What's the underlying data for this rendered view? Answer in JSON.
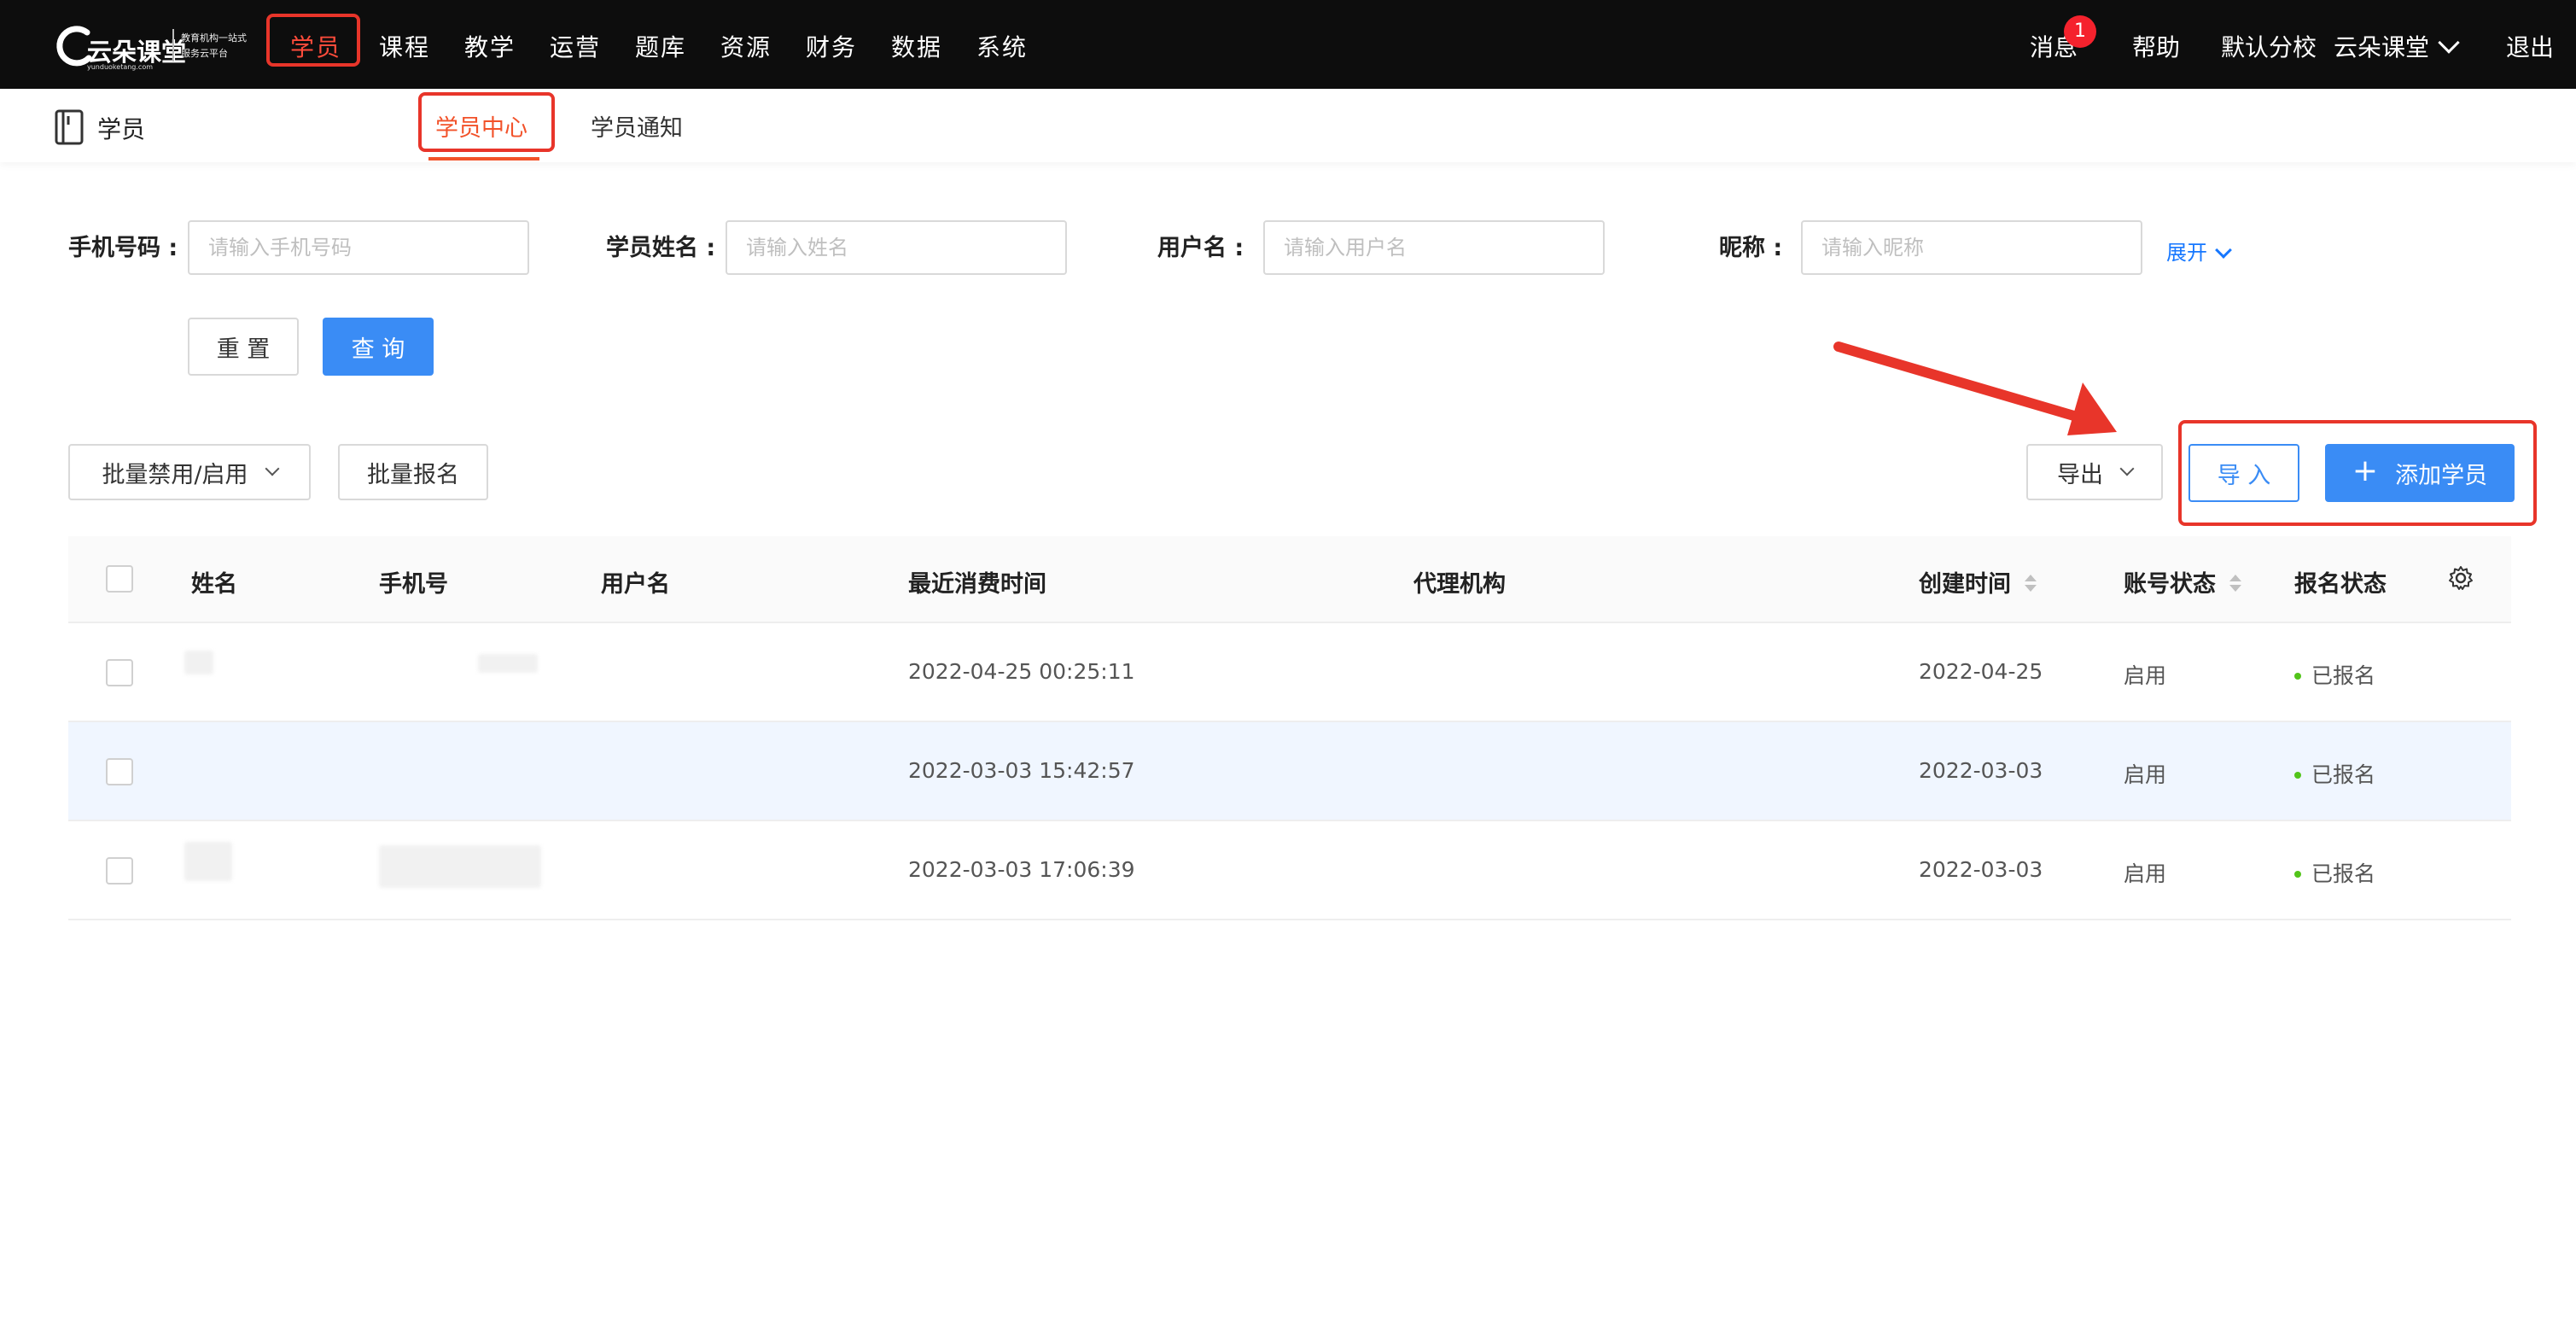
{
  "app": {
    "logo_name": "云朵课堂",
    "logo_domain": "yunduoketang.com",
    "logo_tagline": "教育机构一站式服务云平台"
  },
  "nav": {
    "items": [
      "学员",
      "课程",
      "教学",
      "运营",
      "题库",
      "资源",
      "财务",
      "数据",
      "系统"
    ],
    "active_index": 0
  },
  "top_right": {
    "messages_label": "消息",
    "messages_badge": "1",
    "help_label": "帮助",
    "branch_label": "默认分校",
    "school_label": "云朵课堂",
    "logout_label": "退出"
  },
  "subheader": {
    "section_title": "学员",
    "tabs": [
      "学员中心",
      "学员通知"
    ],
    "active_tab": 0
  },
  "filters": {
    "phone": {
      "label": "手机号码 :",
      "placeholder": "请输入手机号码",
      "value": ""
    },
    "name": {
      "label": "学员姓名 :",
      "placeholder": "请输入姓名",
      "value": ""
    },
    "username": {
      "label": "用户名 :",
      "placeholder": "请输入用户名",
      "value": ""
    },
    "nickname": {
      "label": "昵称 :",
      "placeholder": "请输入昵称",
      "value": ""
    },
    "expand_label": "展开",
    "reset_label": "重 置",
    "query_label": "查 询"
  },
  "toolbar": {
    "batch_toggle_label": "批量禁用/启用",
    "batch_enroll_label": "批量报名",
    "export_label": "导出",
    "import_label": "导 入",
    "add_label": "添加学员"
  },
  "table": {
    "columns": [
      "姓名",
      "手机号",
      "用户名",
      "最近消费时间",
      "代理机构",
      "创建时间",
      "账号状态",
      "报名状态"
    ],
    "rows": [
      {
        "last_purchase": "2022-04-25 00:25:11",
        "created": "2022-04-25",
        "account_status": "启用",
        "enroll_status": "已报名",
        "highlighted": false
      },
      {
        "last_purchase": "2022-03-03 15:42:57",
        "created": "2022-03-03",
        "account_status": "启用",
        "enroll_status": "已报名",
        "highlighted": true
      },
      {
        "last_purchase": "2022-03-03 17:06:39",
        "created": "2022-03-03",
        "account_status": "启用",
        "enroll_status": "已报名",
        "highlighted": false
      }
    ]
  },
  "colors": {
    "topbar_bg": "#0d0d0d",
    "active_nav": "#ff4c3b",
    "annotation_red": "#e8352a",
    "primary_blue": "#3a8cf5",
    "status_dot": "#52c41a"
  },
  "icons": {
    "book": "book-icon",
    "settings": "gear-icon",
    "dropdown": "chevron-down-icon",
    "add": "plus-icon",
    "sort": "sort-icon"
  }
}
